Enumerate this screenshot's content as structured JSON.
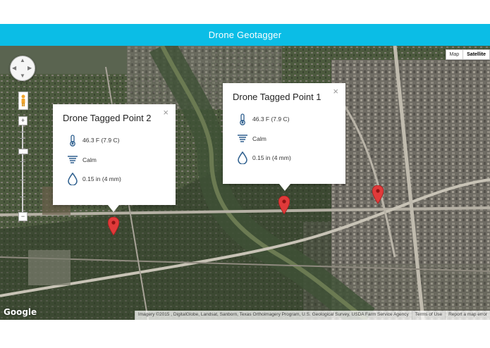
{
  "app": {
    "title": "Drone Geotagger"
  },
  "map": {
    "type_control": {
      "map_label": "Map",
      "satellite_label": "Satellite",
      "active": "Satellite"
    },
    "zoom": {
      "in_label": "+",
      "out_label": "−"
    },
    "logo": "Google",
    "attribution": {
      "imagery": "Imagery ©2015 , DigitalGlobe, Landsat, Sanborn, Texas Orthoimagery Program, U.S. Geological Survey, USDA Farm Service Agency",
      "terms": "Terms of Use",
      "report": "Report a map error"
    },
    "marker_color": "#e03a3a"
  },
  "popups": [
    {
      "title": "Drone Tagged Point 2",
      "close": "×",
      "temperature": "46.3 F (7.9 C)",
      "wind": "Calm",
      "precipitation": "0.15 in (4 mm)",
      "icons": [
        "thermometer-icon",
        "wind-icon",
        "raindrop-icon"
      ]
    },
    {
      "title": "Drone Tagged Point 1",
      "close": "×",
      "temperature": "46.3 F (7.9 C)",
      "wind": "Calm",
      "precipitation": "0.15 in (4 mm)",
      "icons": [
        "thermometer-icon",
        "wind-icon",
        "raindrop-icon"
      ]
    }
  ],
  "colors": {
    "app_bar": "#0bbde6",
    "icon_blue": "#2e5f8e"
  }
}
